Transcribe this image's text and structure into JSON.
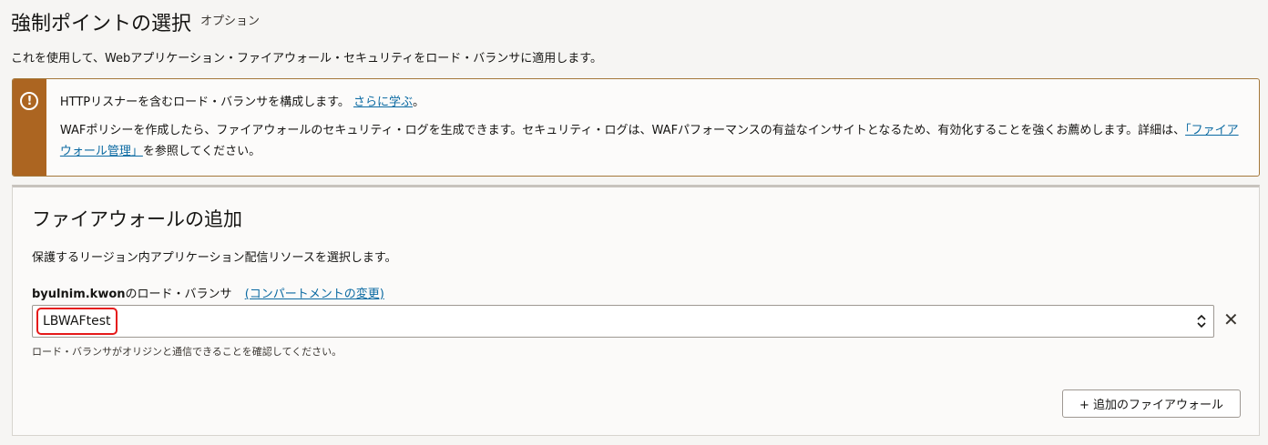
{
  "header": {
    "title": "強制ポイントの選択",
    "optional": "オプション",
    "description": "これを使用して、Webアプリケーション・ファイアウォール・セキュリティをロード・バランサに適用します。"
  },
  "warning": {
    "icon": "exclamation-circle-icon",
    "line1_text": "HTTPリスナーを含むロード・バランサを構成します。",
    "line1_link": "さらに学ぶ",
    "line1_end": "。",
    "line2_text": "WAFポリシーを作成したら、ファイアウォールのセキュリティ・ログを生成できます。セキュリティ・ログは、WAFパフォーマンスの有益なインサイトとなるため、有効化することを強くお薦めします。詳細は、",
    "line2_link": "「ファイアウォール管理」",
    "line2_end": "を参照してください。",
    "bar_color": "#ac6521"
  },
  "firewall_card": {
    "title": "ファイアウォールの追加",
    "description": "保護するリージョン内アプリケーション配信リソースを選択します。",
    "field_label_user": "byulnim.kwon",
    "field_label_suffix": "のロード・バランサ",
    "change_compartment_link": "(コンパートメントの変更)",
    "selected_load_balancer": "LBWAFtest",
    "clear_symbol": "✕",
    "help_text": "ロード・バランサがオリジンと通信できることを確認してください。",
    "add_button_label": "+ 追加のファイアウォール"
  }
}
